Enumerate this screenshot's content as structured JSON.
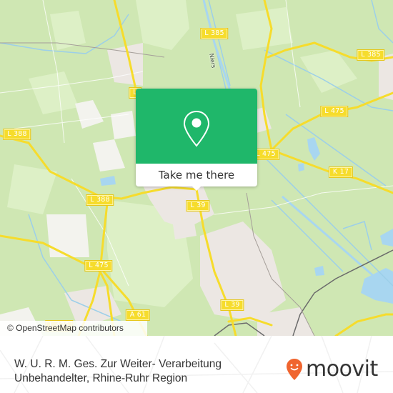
{
  "map": {
    "attribution": "© OpenStreetMap contributors",
    "river_label": "Niers",
    "road_labels": [
      {
        "id": "l385-top",
        "text": "L 385"
      },
      {
        "id": "l385-right",
        "text": "L 385"
      },
      {
        "id": "l475-top-right",
        "text": "L 475"
      },
      {
        "id": "l475-mid",
        "text": "L 475"
      },
      {
        "id": "k17",
        "text": "K 17"
      },
      {
        "id": "l388-left",
        "text": "L 388"
      },
      {
        "id": "l388-mid",
        "text": "L 388"
      },
      {
        "id": "l39-top",
        "text": "L 39"
      },
      {
        "id": "l39-bottom",
        "text": "L 39"
      },
      {
        "id": "l475-left",
        "text": "L 475"
      },
      {
        "id": "a61",
        "text": "A 61"
      },
      {
        "id": "l475-bottom-left",
        "text": "L 475"
      },
      {
        "id": "l-partial",
        "text": "L"
      }
    ],
    "colors": {
      "land": "#cfe7b3",
      "land_light": "#ddf0c6",
      "urban": "#ece7e3",
      "water": "#a8d6f0",
      "road": "#f6dc2c",
      "rail": "#6b6b6b"
    }
  },
  "popup": {
    "action_label": "Take me there",
    "icon": "map-pin-icon",
    "color": "#1fb76a"
  },
  "footer": {
    "place_name": "W. U. R. M. Ges. Zur Weiter- Verarbeitung Unbehandelter, Rhine-Ruhr Region",
    "brand": "moovit",
    "brand_color": "#f0652f"
  }
}
